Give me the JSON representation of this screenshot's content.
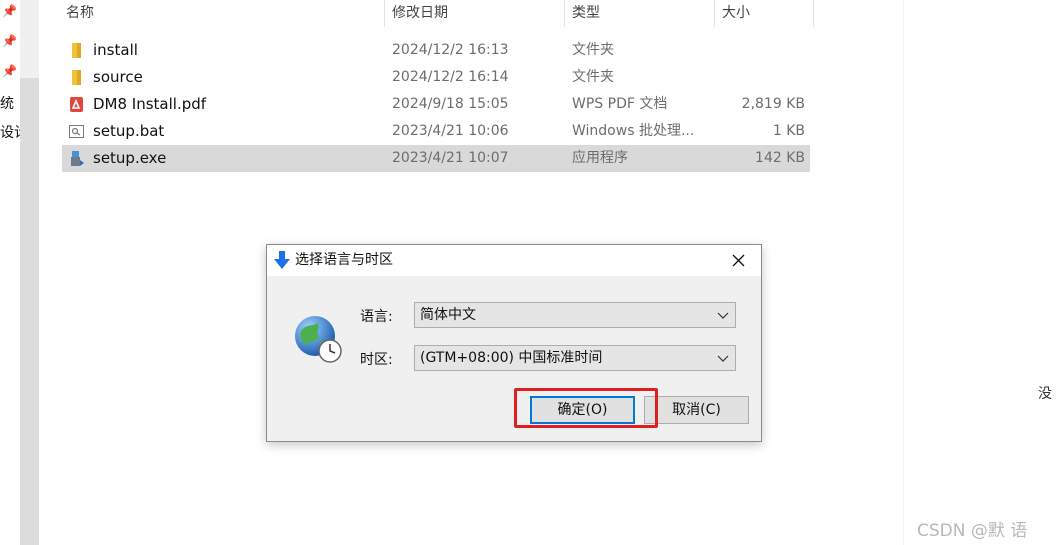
{
  "columns": {
    "name": "名称",
    "date": "修改日期",
    "type": "类型",
    "size": "大小"
  },
  "files": [
    {
      "name": "install",
      "date": "2024/12/2 16:13",
      "type": "文件夹",
      "size": "",
      "icon": "folder-icon"
    },
    {
      "name": "source",
      "date": "2024/12/2 16:14",
      "type": "文件夹",
      "size": "",
      "icon": "folder-icon"
    },
    {
      "name": "DM8 Install.pdf",
      "date": "2024/9/18 15:05",
      "type": "WPS PDF 文档",
      "size": "2,819 KB",
      "icon": "pdf-icon"
    },
    {
      "name": "setup.bat",
      "date": "2023/4/21 10:06",
      "type": "Windows 批处理...",
      "size": "1 KB",
      "icon": "batch-file-icon"
    },
    {
      "name": "setup.exe",
      "date": "2023/4/21 10:07",
      "type": "应用程序",
      "size": "142 KB",
      "icon": "installer-icon",
      "selected": true
    }
  ],
  "nav_fragments": [
    "统",
    "设计"
  ],
  "dialog": {
    "title": "选择语言与时区",
    "language_label": "语言:",
    "language_value": "简体中文",
    "timezone_label": "时区:",
    "timezone_value": "(GTM+08:00) 中国标准时间",
    "ok_label": "确定(O)",
    "cancel_label": "取消(C)"
  },
  "right_fragment": "没",
  "watermark": "CSDN @默  语",
  "colors": {
    "highlight": "#e02020",
    "selection": "#d9d9d9",
    "accent": "#0078d7"
  }
}
